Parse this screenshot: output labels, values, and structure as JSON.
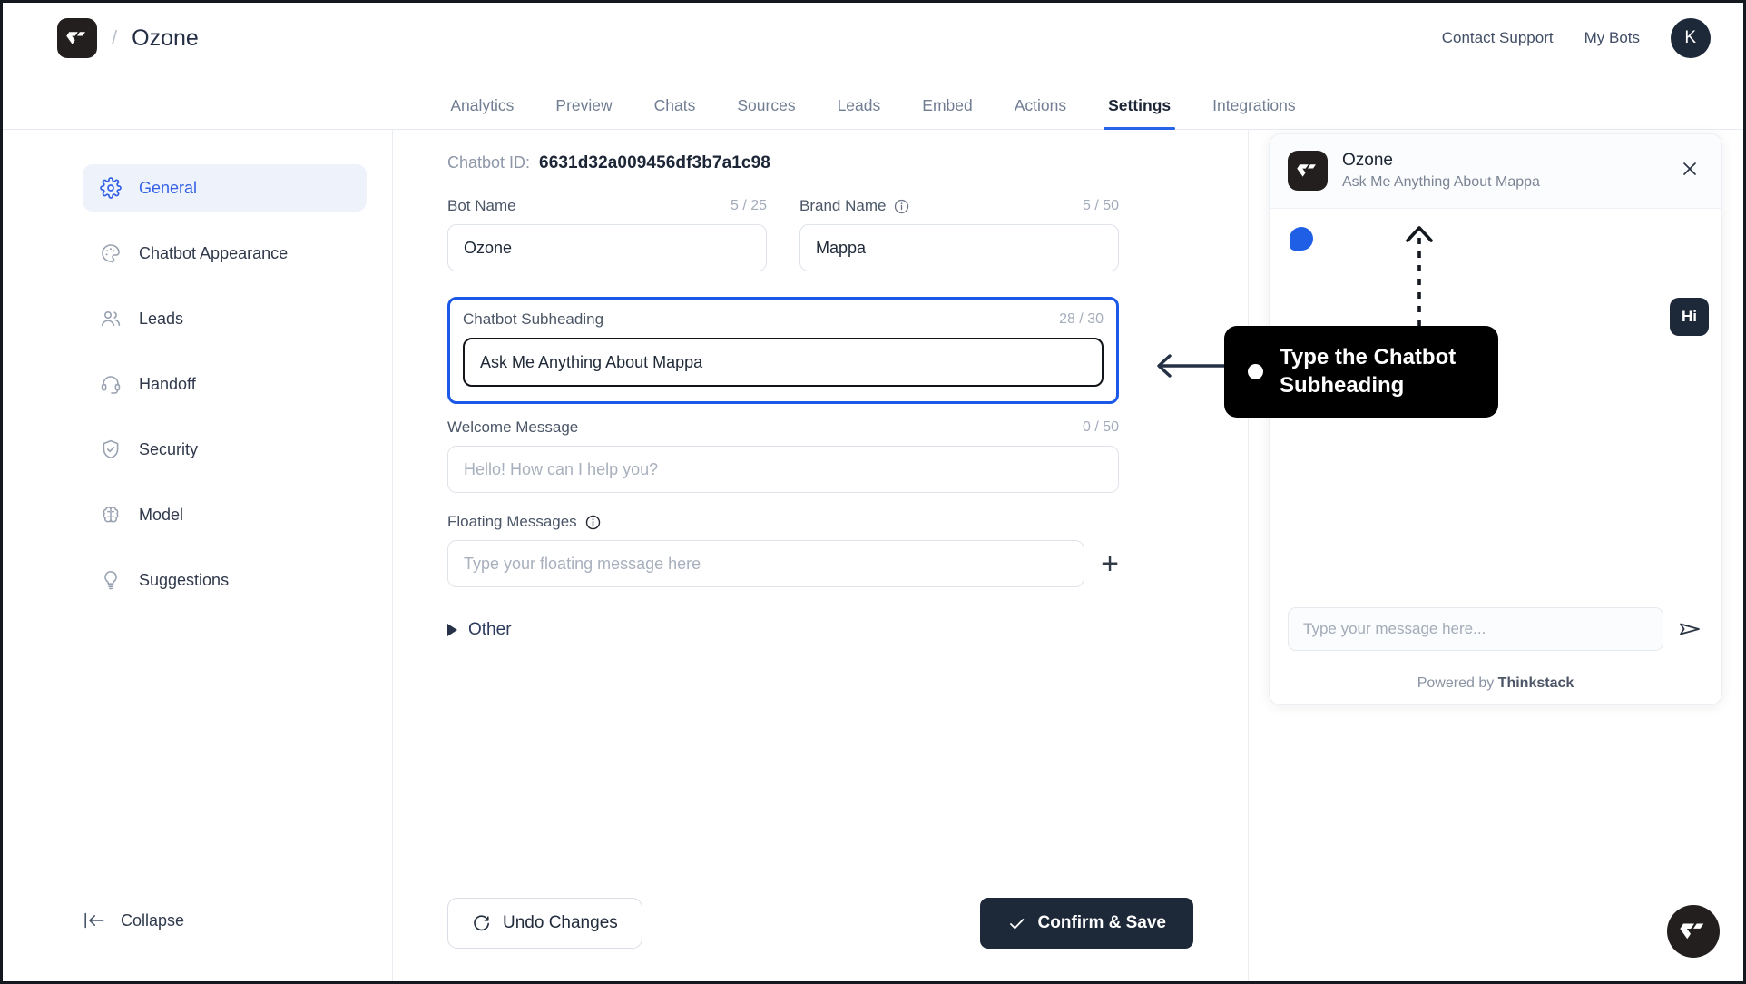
{
  "header": {
    "logo_icon": "thinkstack-logo-icon",
    "separator": "/",
    "bot_name": "Ozone",
    "links": [
      {
        "label": "Contact Support",
        "name": "contact-support-link"
      },
      {
        "label": "My Bots",
        "name": "my-bots-link"
      }
    ],
    "avatar_initial": "K"
  },
  "tabs": [
    {
      "label": "Analytics",
      "active": false
    },
    {
      "label": "Preview",
      "active": false
    },
    {
      "label": "Chats",
      "active": false
    },
    {
      "label": "Sources",
      "active": false
    },
    {
      "label": "Leads",
      "active": false
    },
    {
      "label": "Embed",
      "active": false
    },
    {
      "label": "Actions",
      "active": false
    },
    {
      "label": "Settings",
      "active": true
    },
    {
      "label": "Integrations",
      "active": false
    }
  ],
  "sidebar": {
    "items": [
      {
        "label": "General",
        "icon": "gear-icon",
        "active": true
      },
      {
        "label": "Chatbot Appearance",
        "icon": "palette-icon",
        "active": false
      },
      {
        "label": "Leads",
        "icon": "users-icon",
        "active": false
      },
      {
        "label": "Handoff",
        "icon": "headset-icon",
        "active": false
      },
      {
        "label": "Security",
        "icon": "shield-check-icon",
        "active": false
      },
      {
        "label": "Model",
        "icon": "brain-icon",
        "active": false
      },
      {
        "label": "Suggestions",
        "icon": "lightbulb-icon",
        "active": false
      }
    ],
    "collapse_label": "Collapse",
    "collapse_icon": "collapse-arrow-icon"
  },
  "form": {
    "chatbot_id_label": "Chatbot ID:",
    "chatbot_id_value": "6631d32a009456df3b7a1c98",
    "bot_name": {
      "label": "Bot Name",
      "count": "5 / 25",
      "value": "Ozone"
    },
    "brand_name": {
      "label": "Brand Name",
      "count": "5 / 50",
      "value": "Mappa",
      "info_icon": "info-icon"
    },
    "chatbot_subheading": {
      "label": "Chatbot Subheading",
      "count": "28 / 30",
      "value": "Ask Me Anything About Mappa"
    },
    "welcome_message": {
      "label": "Welcome Message",
      "count": "0 / 50",
      "value": "",
      "placeholder": "Hello! How can I help you?"
    },
    "floating_messages": {
      "label": "Floating Messages",
      "placeholder": "Type your floating message here",
      "info_icon": "info-icon",
      "add_icon": "plus-icon"
    },
    "other_section": {
      "label": "Other",
      "expanded": false,
      "icon": "triangle-right-icon"
    },
    "undo_button": {
      "label": "Undo Changes",
      "icon": "refresh-icon"
    },
    "save_button": {
      "label": "Confirm & Save",
      "icon": "check-icon"
    }
  },
  "preview": {
    "title": "Ozone",
    "subheading": "Ask Me Anything About Mappa",
    "close_icon": "close-icon",
    "logo_icon": "thinkstack-logo-icon",
    "bot_typing_icon": "bot-bubble-icon",
    "user_message": "Hi",
    "input_placeholder": "Type your message here...",
    "send_icon": "send-icon",
    "powered_prefix": "Powered by ",
    "powered_brand": "Thinkstack",
    "launcher_icon": "chat-launcher-icon"
  },
  "annotation": {
    "tooltip_text": "Type the Chatbot Subheading",
    "highlight_color": "#1b58e8"
  }
}
